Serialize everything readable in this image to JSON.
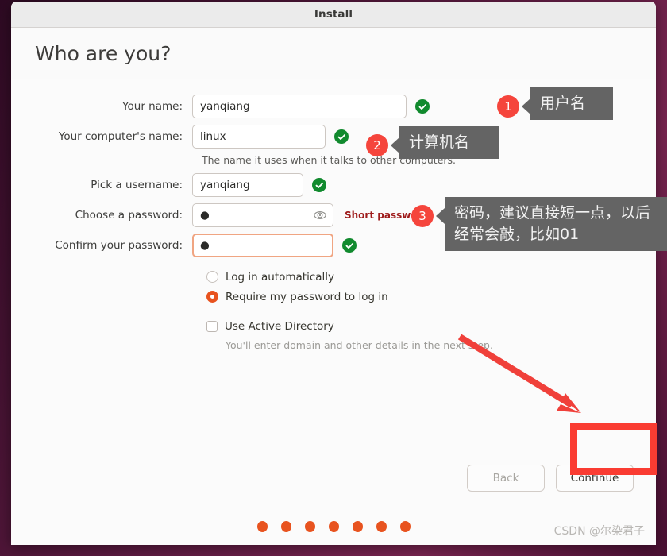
{
  "window": {
    "title": "Install"
  },
  "header": {
    "page_title": "Who are you?"
  },
  "form": {
    "rows": [
      {
        "label": "Your name:",
        "value": "yanqiang",
        "valid": true
      },
      {
        "label": "Your computer's name:",
        "value": "linux",
        "valid": true
      },
      {
        "label": "Pick a username:",
        "value": "yanqiang",
        "valid": true
      },
      {
        "label": "Choose a password:",
        "value": "●",
        "valid": false
      },
      {
        "label": "Confirm your password:",
        "value": "●",
        "valid": true
      }
    ],
    "computer_name_hint": "The name it uses when it talks to other computers.",
    "short_password_warning": "Short password",
    "reveal_password_icon": "eye-icon",
    "check_icon": "check-circle-icon"
  },
  "options": {
    "login_auto_label": "Log in automatically",
    "require_password_label": "Require my password to log in",
    "selected_login_option": "Require my password to log in",
    "active_directory_label": "Use Active Directory",
    "active_directory_checked": false,
    "active_directory_hint": "You'll enter domain and other details in the next step."
  },
  "buttons": {
    "back": "Back",
    "continue": "Continue"
  },
  "progress": {
    "dot_count": 7
  },
  "annotations": {
    "callouts": [
      {
        "number": "1",
        "text": "用户名"
      },
      {
        "number": "2",
        "text": "计算机名"
      },
      {
        "number": "3",
        "text": "密码，建议直接短一点，以后经常会敲，比如01"
      }
    ]
  },
  "watermark": {
    "text": "CSDN @尔染君子"
  },
  "colors": {
    "accent_orange": "#e8531f",
    "badge_red": "#f5453c",
    "highlight_red": "#fa3c32",
    "valid_green": "#118a2e",
    "warning_red": "#9e1b1b",
    "callout_gray": "#646464",
    "desktop_aubergine": "#5b1a40"
  }
}
